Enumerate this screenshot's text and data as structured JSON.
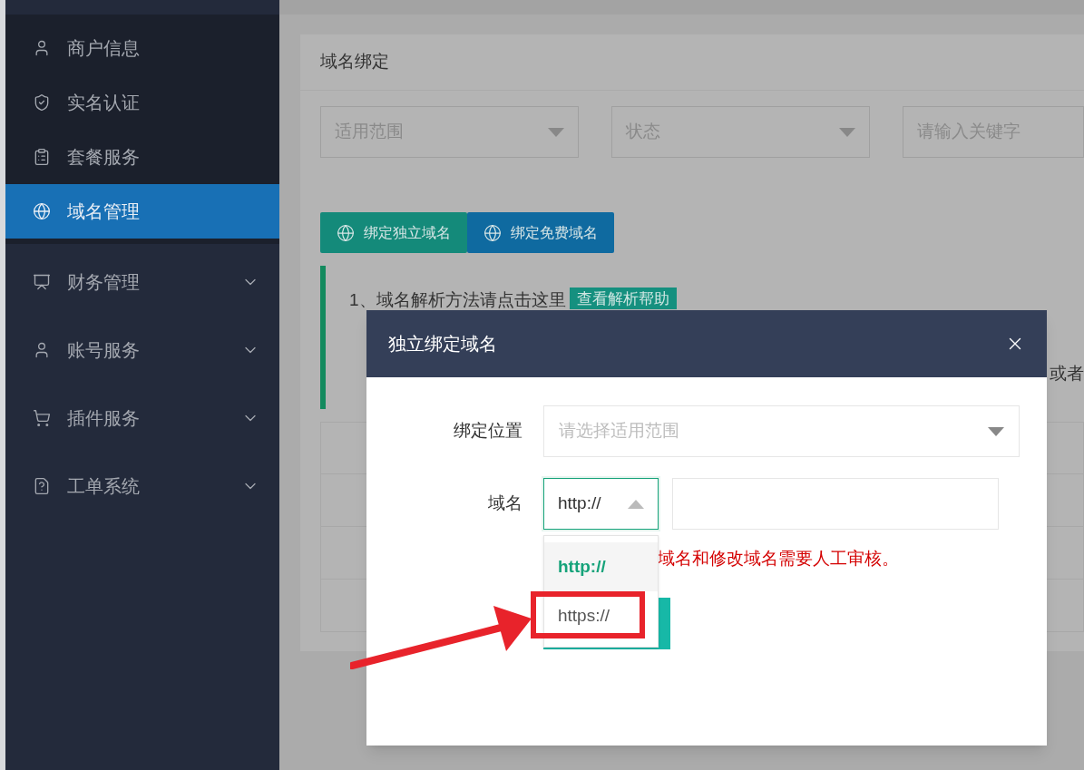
{
  "sidebar": {
    "items": [
      {
        "label": "商户信息",
        "kind": "sub",
        "selected": false
      },
      {
        "label": "实名认证",
        "kind": "sub",
        "selected": false
      },
      {
        "label": "套餐服务",
        "kind": "sub",
        "selected": false
      },
      {
        "label": "域名管理",
        "kind": "sub",
        "selected": true
      },
      {
        "label": "财务管理",
        "kind": "group",
        "expanded": false
      },
      {
        "label": "账号服务",
        "kind": "group",
        "expanded": false
      },
      {
        "label": "插件服务",
        "kind": "group",
        "expanded": false
      },
      {
        "label": "工单系统",
        "kind": "group",
        "expanded": false
      }
    ]
  },
  "card": {
    "title": "域名绑定",
    "filters": [
      {
        "kind": "select",
        "placeholder": "适用范围"
      },
      {
        "kind": "select",
        "placeholder": "状态"
      },
      {
        "kind": "input",
        "placeholder": "请输入关键字"
      }
    ],
    "buttons": [
      {
        "label": "绑定独立域名",
        "color": "#148a7a"
      },
      {
        "label": "绑定免费域名",
        "color": "#0f6aa0"
      }
    ],
    "notice": {
      "text": "1、域名解析方法请点击这里",
      "link": "查看解析帮助",
      "trailing": "或者"
    }
  },
  "dialog": {
    "title": "独立绑定域名",
    "fields": [
      {
        "label": "绑定位置",
        "placeholder": "请选择适用范围"
      },
      {
        "label": "域名",
        "protocol": "http://",
        "expanded": true
      }
    ],
    "protocol_options": [
      {
        "label": "http://",
        "selected": true
      },
      {
        "label": "https://",
        "selected": false
      }
    ],
    "hint": "域名和修改域名需要人工审核。"
  }
}
